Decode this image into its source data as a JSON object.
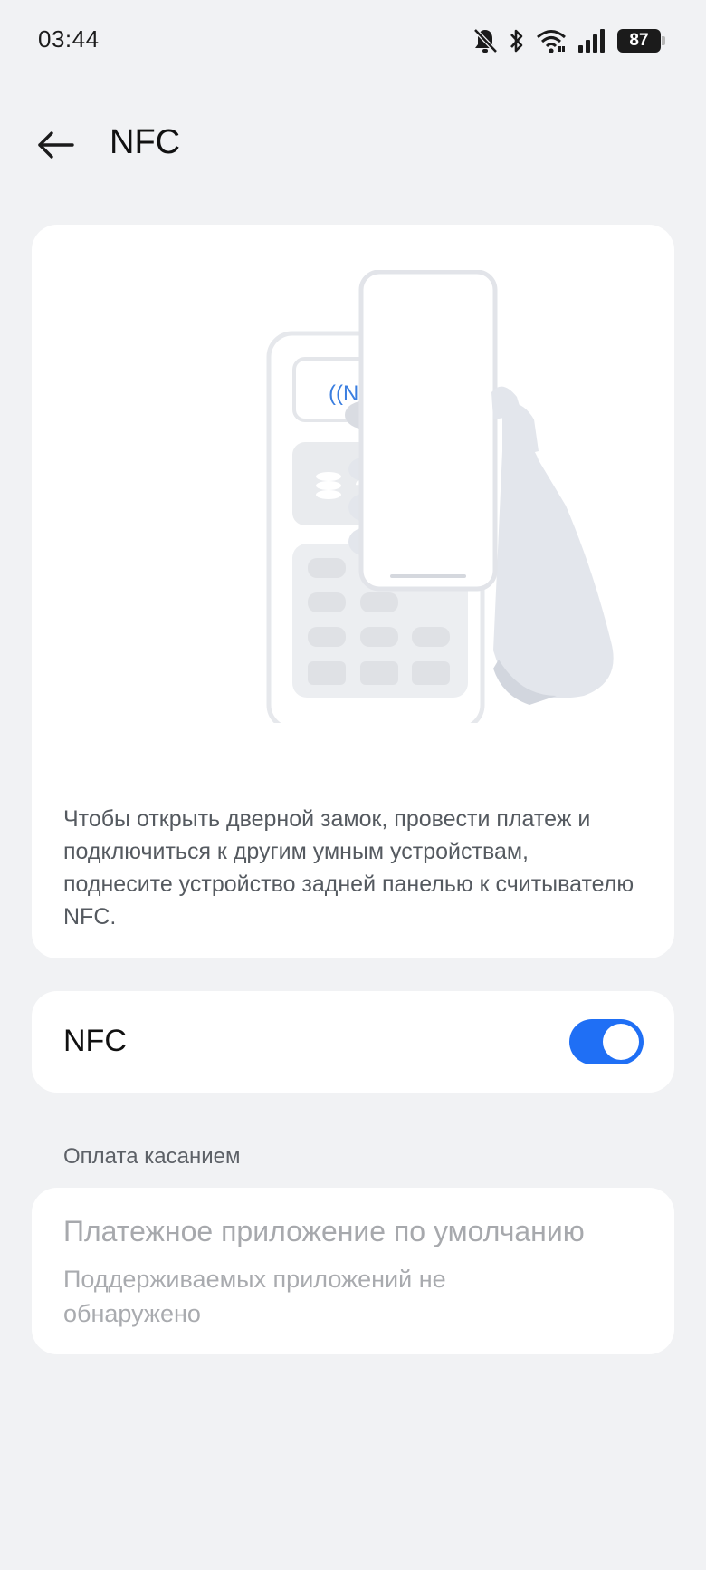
{
  "status_bar": {
    "time": "03:44",
    "battery": "87",
    "icons": [
      "bell-off-icon",
      "bluetooth-icon",
      "wifi-icon",
      "signal-icon",
      "battery-icon"
    ]
  },
  "header": {
    "back_icon": "arrow-left-icon",
    "title": "NFC"
  },
  "illustration": {
    "description": "Чтобы открыть дверной замок, провести платеж и подключиться к другим умным устройствам, поднесите устройство задней панелью к считывателю NFC.",
    "accent_color": "#3a7ee0"
  },
  "nfc_toggle": {
    "label": "NFC",
    "enabled": true,
    "color": "#1f6ff5"
  },
  "payment_section": {
    "header": "Оплата касанием",
    "default_app_title": "Платежное приложение по умолчанию",
    "default_app_subtitle": "Поддерживаемых приложений не обнаружено"
  }
}
